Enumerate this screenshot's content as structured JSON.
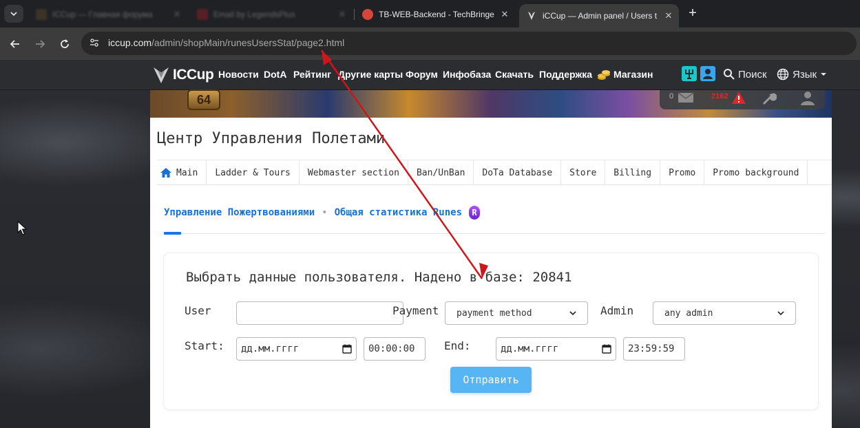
{
  "browser": {
    "tabs": [
      {
        "title": "ICCup — Главная форума",
        "active": false,
        "dim": true
      },
      {
        "title": "Email by LegendsPlus",
        "active": false,
        "dim": true
      },
      {
        "title": "TB-WEB-Backend - TechBringer",
        "active": false,
        "dim": false
      },
      {
        "title": "iCCup — Admin panel / Users t",
        "active": true,
        "dim": false
      }
    ],
    "new_tab_label": "+",
    "url_host": "iccup.com",
    "url_path": "/admin/shopMain/runesUsersStat/page2.html"
  },
  "site_nav": {
    "logo_text": "ICCup",
    "items": [
      "Новости",
      "DotA",
      "Рейтинг",
      "Другие карты",
      "Форум",
      "Инфобаза",
      "Скачать",
      "Поддержка",
      "Магазин"
    ],
    "search_label": "Поиск",
    "lang_label": "Язык"
  },
  "user_panel": {
    "level": "64",
    "messages": "0",
    "alerts": "2162"
  },
  "page": {
    "title": "Центр Управления Полетами",
    "admin_tabs": [
      "Main",
      "Ladder & Tours",
      "Webmaster section",
      "Ban/UnBan",
      "DoTa Database",
      "Store",
      "Billing",
      "Promo",
      "Promo background"
    ],
    "breadcrumb_donations": "Управление Пожертвованиями",
    "breadcrumb_sep": "•",
    "breadcrumb_runes": "Общая статистика Runes",
    "rune_icon_letter": "R"
  },
  "form": {
    "heading": "Выбрать данные пользователя. Надено в базе: 20841",
    "user_label": "User",
    "user_value": "",
    "payment_label": "Payment",
    "payment_selected": "payment method",
    "admin_label": "Admin",
    "admin_selected": "any admin",
    "start_label": "Start:",
    "start_date": "дд.мм.гггг",
    "start_time": "00:00:00",
    "end_label": "End:",
    "end_date": "дд.мм.гггг",
    "end_time": "23:59:59",
    "submit_label": "Отправить"
  },
  "colors": {
    "link": "#1a6fd1",
    "submit": "#58b5f3",
    "annotation_arrow": "#d0161b",
    "alert": "#e0262b"
  }
}
